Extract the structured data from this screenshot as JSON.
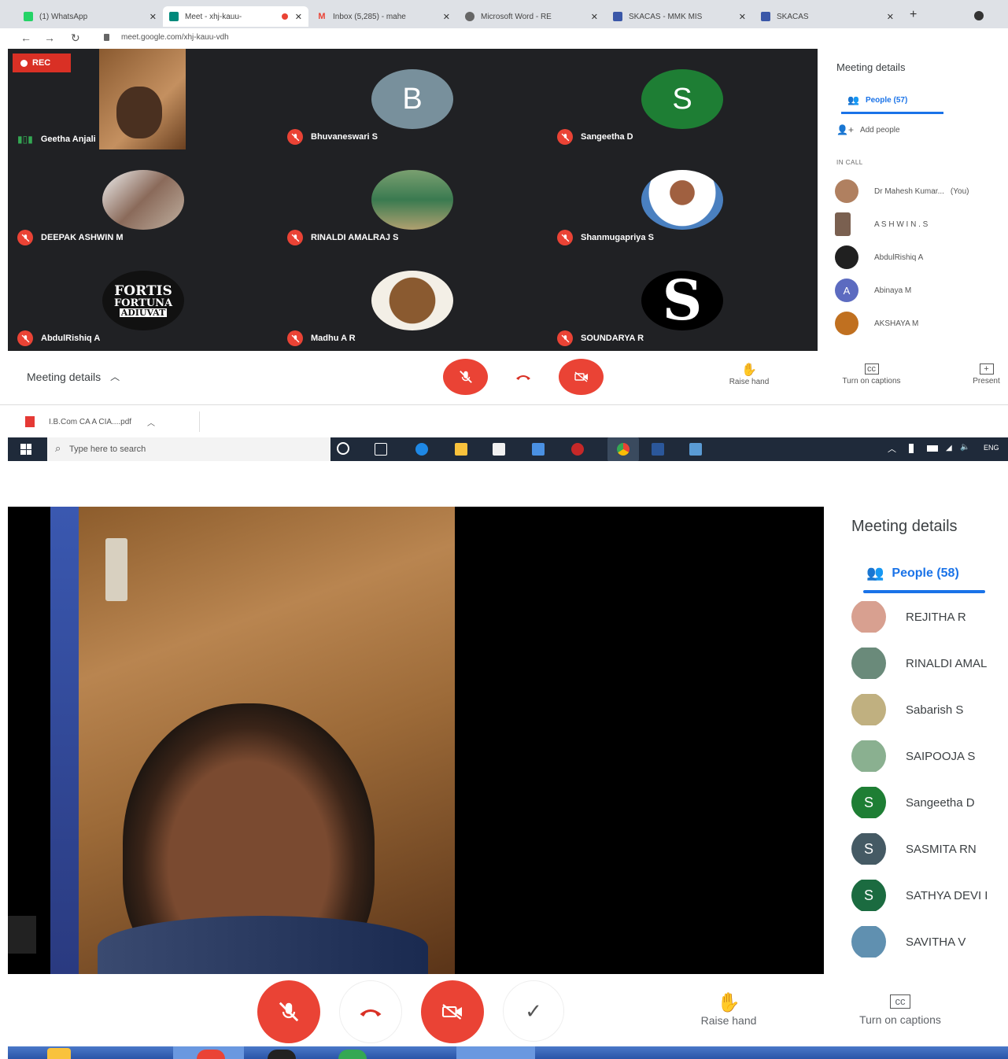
{
  "shot1": {
    "tabs": [
      {
        "label": "(1) WhatsApp",
        "favicon": "whatsapp-icon",
        "color": "#25d366"
      },
      {
        "label": "Meet - xhj-kauu-",
        "favicon": "meet-icon",
        "color": "#00897b"
      },
      {
        "label": "Inbox (5,285) - mahe",
        "favicon": "gmail-icon",
        "color": "#ea4335"
      },
      {
        "label": "Microsoft Word - RE",
        "favicon": "globe-icon",
        "color": "#666666"
      },
      {
        "label": "SKACAS - MMK MIS",
        "favicon": "site-icon",
        "color": "#3a57a8"
      },
      {
        "label": "SKACAS",
        "favicon": "site-icon",
        "color": "#3a57a8"
      }
    ],
    "url": "meet.google.com/xhj-kauu-vdh",
    "rec_label": "REC",
    "tiles": [
      {
        "name": "Geetha Anjali",
        "type": "video"
      },
      {
        "name": "Bhuvaneswari S",
        "initial": "B",
        "color": "#78909c"
      },
      {
        "name": "Sangeetha D",
        "initial": "S",
        "color": "#1e7e34"
      },
      {
        "name": "DEEPAK ASHWIN M",
        "type": "photo"
      },
      {
        "name": "RINALDI AMALRAJ S",
        "type": "photo"
      },
      {
        "name": "Shanmugapriya S",
        "type": "photo"
      },
      {
        "name": "AbdulRishiq A",
        "type": "logo",
        "logo_lines": [
          "FORTIS",
          "FORTUNA",
          "ADIUVAT"
        ]
      },
      {
        "name": "Madhu A R",
        "type": "photo"
      },
      {
        "name": "SOUNDARYA R",
        "type": "logo-s",
        "logo_letter": "S"
      }
    ],
    "panel": {
      "title": "Meeting details",
      "people_tab": "People (57)",
      "add_people": "Add people",
      "section": "IN CALL",
      "people": [
        {
          "name": "Dr Mahesh Kumar...",
          "suffix": "(You)",
          "color": "#b08060"
        },
        {
          "name": "A S H W I N . S",
          "color": "#7a6050"
        },
        {
          "name": "AbdulRishiq A",
          "color": "#202020"
        },
        {
          "name": "Abinaya M",
          "initial": "A",
          "color": "#5c6bc0"
        },
        {
          "name": "AKSHAYA M",
          "color": "#c07020"
        }
      ]
    },
    "meeting_details_label": "Meeting details",
    "controls": {
      "raise_hand": "Raise hand",
      "captions": "Turn on captions",
      "present": "Present"
    },
    "download": "I.B.Com CA A CIA....pdf",
    "taskbar": {
      "search_placeholder": "Type here to search",
      "lang": "ENG"
    }
  },
  "shot2": {
    "panel": {
      "title": "Meeting details",
      "people_tab": "People (58)",
      "people": [
        {
          "name": "REJITHA R",
          "color": "#d8a090"
        },
        {
          "name": "RINALDI AMAL",
          "color": "#6a8a7a"
        },
        {
          "name": "Sabarish S",
          "color": "#c0b080"
        },
        {
          "name": "SAIPOOJA S",
          "color": "#8ab090"
        },
        {
          "name": "Sangeetha D",
          "initial": "S",
          "color": "#1e7e34"
        },
        {
          "name": "SASMITA RN",
          "initial": "S",
          "color": "#455a64"
        },
        {
          "name": "SATHYA DEVI I",
          "initial": "S",
          "color": "#1b6b40"
        },
        {
          "name": "SAVITHA V",
          "color": "#6090b0"
        }
      ]
    },
    "controls": {
      "raise_hand": "Raise hand",
      "captions": "Turn on captions"
    }
  }
}
